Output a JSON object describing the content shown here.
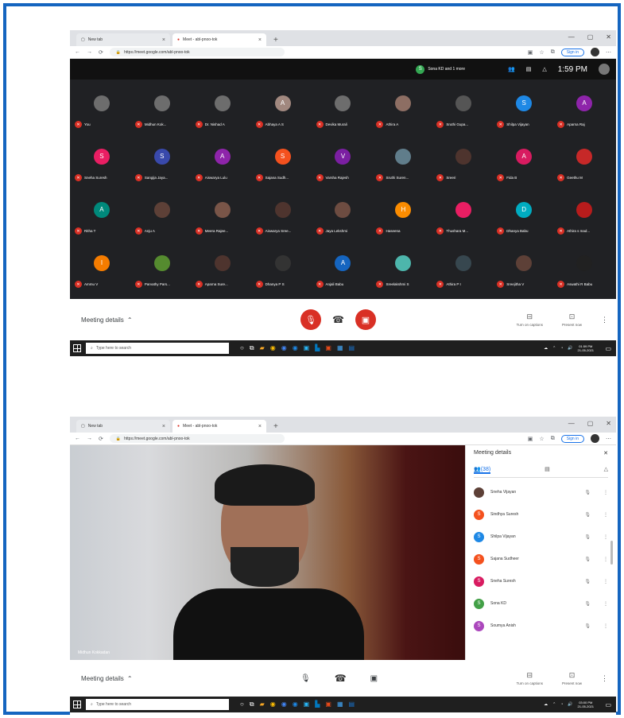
{
  "shot1": {
    "tabs": [
      {
        "label": "New tab"
      },
      {
        "label": "Meet - abl-pnoo-tok"
      }
    ],
    "url": "https://meet.google.com/abl-pnoo-tok",
    "signin": "Sign in",
    "top_bar": {
      "people_text": "Sona KD and 1 more",
      "people_initial": "S",
      "clock": "1:59 PM"
    },
    "participants": [
      {
        "name": "You",
        "initial": "",
        "color": "#6d6d6d"
      },
      {
        "name": "Midhun Kok...",
        "initial": "",
        "color": "#6d6d6d"
      },
      {
        "name": "Dr. Nishad A",
        "initial": "",
        "color": "#6d6d6d"
      },
      {
        "name": "Abhaya A S",
        "initial": "A",
        "color": "#a1887f"
      },
      {
        "name": "Devika Murali",
        "initial": "",
        "color": "#6d6d6d"
      },
      {
        "name": "Athira A",
        "initial": "",
        "color": "#8d6e63"
      },
      {
        "name": "Sruthi Gupa...",
        "initial": "",
        "color": "#555"
      },
      {
        "name": "Shilpa Vijayan",
        "initial": "S",
        "color": "#1e88e5"
      },
      {
        "name": "Aparna Raj",
        "initial": "A",
        "color": "#8e24aa"
      },
      {
        "name": "Sneha Suresh",
        "initial": "S",
        "color": "#e91e63"
      },
      {
        "name": "Sangija Jaya...",
        "initial": "S",
        "color": "#3949ab"
      },
      {
        "name": "Aiswarya Lulu",
        "initial": "A",
        "color": "#8e24aa"
      },
      {
        "name": "Sajana Sudh...",
        "initial": "S",
        "color": "#f4511e"
      },
      {
        "name": "Varsha Rajesh",
        "initial": "V",
        "color": "#7b1fa2"
      },
      {
        "name": "Sruthi Suren...",
        "initial": "",
        "color": "#607d8b"
      },
      {
        "name": "Sreeri",
        "initial": "",
        "color": "#4e342e"
      },
      {
        "name": "Fida B",
        "initial": "A",
        "color": "#d81b60"
      },
      {
        "name": "Geethu M",
        "initial": "",
        "color": "#c62828"
      },
      {
        "name": "Ritha T",
        "initial": "A",
        "color": "#00897b"
      },
      {
        "name": "Anju A",
        "initial": "",
        "color": "#5d4037"
      },
      {
        "name": "Meera Rajee...",
        "initial": "",
        "color": "#795548"
      },
      {
        "name": "Aiswarya Sree...",
        "initial": "",
        "color": "#4e342e"
      },
      {
        "name": "Jaya Lekshmi",
        "initial": "",
        "color": "#6d4c41"
      },
      {
        "name": "Haseena",
        "initial": "H",
        "color": "#fb8c00"
      },
      {
        "name": "Thushara M...",
        "initial": "",
        "color": "#e91e63"
      },
      {
        "name": "Dhanya Babu",
        "initial": "D",
        "color": "#00acc1"
      },
      {
        "name": "Athira s mad...",
        "initial": "",
        "color": "#b71c1c"
      },
      {
        "name": "Ammu V",
        "initial": "I",
        "color": "#f57c00"
      },
      {
        "name": "Parvathy Pars...",
        "initial": "",
        "color": "#558b2f"
      },
      {
        "name": "Aparna Sure...",
        "initial": "",
        "color": "#4e342e"
      },
      {
        "name": "Dhanya P S",
        "initial": "",
        "color": "#333"
      },
      {
        "name": "Anjali Babu",
        "initial": "A",
        "color": "#1565c0"
      },
      {
        "name": "Sreelakshmi S",
        "initial": "",
        "color": "#4db6ac"
      },
      {
        "name": "Athira P I",
        "initial": "",
        "color": "#37474f"
      },
      {
        "name": "Sreejitha V",
        "initial": "",
        "color": "#5d4037"
      },
      {
        "name": "Aswathi R Babu",
        "initial": "",
        "color": "#212121"
      }
    ],
    "controls": {
      "meeting_details": "Meeting details",
      "captions": "Turn on captions",
      "present": "Present now"
    },
    "taskbar": {
      "search": "Type here to search",
      "time": "01:59 PM",
      "date": "21-05-2021"
    }
  },
  "shot2": {
    "tabs": [
      {
        "label": "New tab"
      },
      {
        "label": "Meet - abl-pnoo-tok"
      }
    ],
    "url": "https://meet.google.com/abl-pnoo-tok",
    "signin": "Sign in",
    "video_label": "Midhun Kokkadan",
    "panel": {
      "title": "Meeting details",
      "tab_people": "(38)",
      "people": [
        {
          "name": "Sneha Vijayan",
          "initial": "",
          "color": "#5d4037"
        },
        {
          "name": "Sindhya Suresh",
          "initial": "S",
          "color": "#f4511e"
        },
        {
          "name": "Shilpa Vijayan",
          "initial": "S",
          "color": "#1e88e5"
        },
        {
          "name": "Sajana Sudheer",
          "initial": "S",
          "color": "#f4511e"
        },
        {
          "name": "Sneha Suresh",
          "initial": "S",
          "color": "#d81b60"
        },
        {
          "name": "Sona KD",
          "initial": "S",
          "color": "#43a047"
        },
        {
          "name": "Soumya Anish",
          "initial": "S",
          "color": "#ab47bc"
        }
      ]
    },
    "controls": {
      "meeting_details": "Meeting details",
      "captions": "Turn on captions",
      "present": "Present now"
    },
    "taskbar": {
      "search": "Type here to search",
      "time": "03:00 PM",
      "date": "21-05-2021"
    }
  }
}
